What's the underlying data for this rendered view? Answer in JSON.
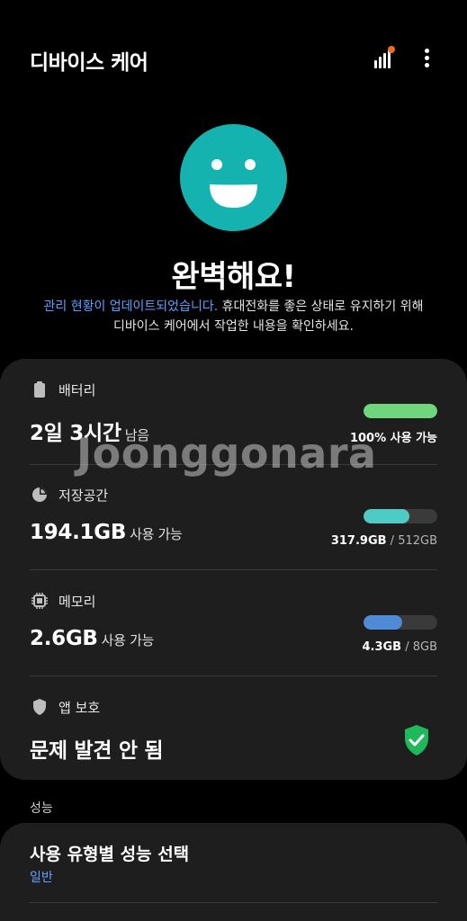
{
  "app": {
    "title": "디바이스 케어"
  },
  "header": {
    "signal_icon": "signal-bars-icon",
    "more_icon": "more-vert-icon",
    "notification_dot_color": "#f26b1d"
  },
  "status": {
    "face_color": "#14b3b0",
    "title": "완벽해요!",
    "subtitle_link": "관리 현황이 업데이트되었습니다.",
    "subtitle_line1": " 휴대전화를 좋은 상태로 유지하기 위해",
    "subtitle_line2": "디바이스 케어에서 작업한 내용을 확인하세요."
  },
  "battery": {
    "label": "배터리",
    "icon": "battery-icon",
    "value": "2일 3시간",
    "unit": "남음",
    "level_fraction": 1.0,
    "bar_color": "#6fd67e",
    "meta": "100% 사용 가능"
  },
  "storage": {
    "label": "저장공간",
    "icon": "pie-chart-icon",
    "value": "194.1GB",
    "unit": "사용 가능",
    "used_fraction": 0.62,
    "bar_color": "#4fcac4",
    "used": "317.9GB",
    "sep": " / ",
    "total": "512GB"
  },
  "memory": {
    "label": "메모리",
    "icon": "memory-chip-icon",
    "value": "2.6GB",
    "unit": "사용 가능",
    "used_fraction": 0.53,
    "bar_color": "#4f8ad6",
    "used": "4.3GB",
    "sep": " / ",
    "total": "8GB"
  },
  "app_protection": {
    "label": "앱 보호",
    "icon": "shield-icon",
    "value": "문제 발견 안 됨",
    "status_icon": "shield-check-icon",
    "status_color": "#1fb85a"
  },
  "watermark": "Joonggonara",
  "performance": {
    "section_label": "성능",
    "title": "사용 유형별 성능 선택",
    "value": "일반"
  }
}
